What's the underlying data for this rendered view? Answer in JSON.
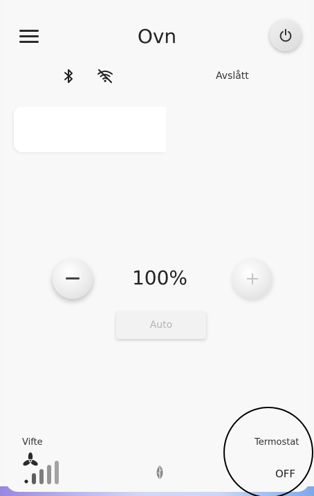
{
  "header": {
    "title": "Ovn",
    "menu_icon": "hamburger-menu-icon",
    "power_icon": "power-icon"
  },
  "status": {
    "bluetooth_icon": "bluetooth-icon",
    "wifi_icon": "wifi-off-icon",
    "state_text": "Avslått"
  },
  "control": {
    "value": "100%",
    "minus_label": "−",
    "plus_label": "+",
    "auto_label": "Auto"
  },
  "bottom": {
    "fan_label": "Vifte",
    "fan_icon": "fan-speed-icon",
    "eco_icon": "leaf-icon",
    "thermostat_label": "Termostat",
    "thermostat_value": "OFF"
  },
  "colors": {
    "background": "#f8f8f8",
    "text": "#232323",
    "disabled_text": "#b4b4b4"
  }
}
